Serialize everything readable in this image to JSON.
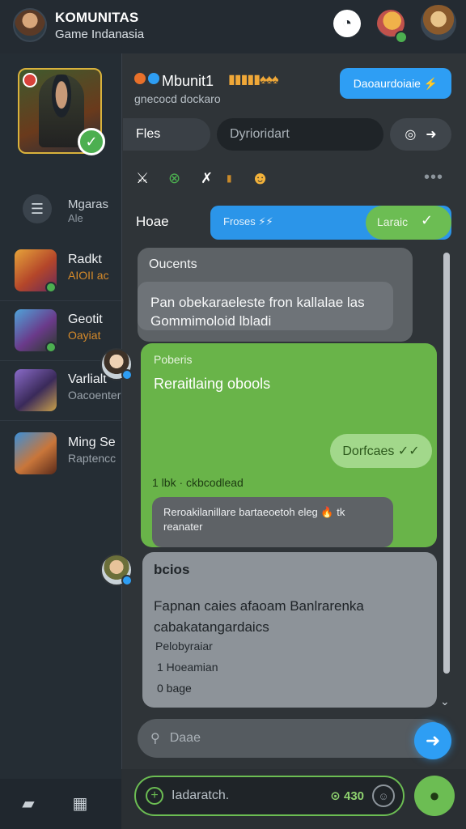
{
  "header": {
    "title": "KOMUNITAS",
    "subtitle": "Game Indanasia"
  },
  "sidebar": {
    "menu": {
      "title": "Mgaras",
      "sub": "Ale"
    },
    "games": [
      {
        "name": "Radkt",
        "sub": "AIOII ac",
        "sub_color": "#d58a2a"
      },
      {
        "name": "Geotit",
        "sub": "Oayiat",
        "sub_color": "#d58a2a"
      },
      {
        "name": "Varlialt",
        "sub": "Oacoenter",
        "sub_color": "#9aa3ab"
      },
      {
        "name": "Ming Se",
        "sub": "Raptencc",
        "sub_color": "#9aa3ab"
      }
    ]
  },
  "channel": {
    "title": "Mbunit1",
    "emoji": "▮▮▮▮▮♠♠♠",
    "subtitle": "gnecocd dockaro",
    "join_label": "Daoaurdoiaie ⚡"
  },
  "toolbar": {
    "files_label": "Fles",
    "search_placeholder": "Dyrioridart"
  },
  "progress": {
    "home_label": "Hoae",
    "label": "Froses ⚡⚡",
    "right_label": "Laraic",
    "value": 0.3
  },
  "messages": [
    {
      "title": "Oucents",
      "text": "Pan obekaraeleste fron kallalae las Gommimoloid lbladi"
    },
    {
      "author": "Poberis",
      "text": "Reraitlaing obools",
      "reply_label": "Dorfcaes ✓✓",
      "meta": "1 lbk · ckbcodlead",
      "quote": "Reroakilanillare bartaeoetoh eleg 🔥 tk reanater"
    },
    {
      "title": "bcios",
      "text": "Fapnan caies afaoam Banlrarenka cabakatangardaics",
      "line2": "Pelobyraiar",
      "line3": "1 Hoeamian",
      "line4": "0 bage"
    }
  ],
  "composer": {
    "placeholder": "Daae"
  },
  "bottom_input": {
    "placeholder": "Iadaratch.",
    "count": "⊙ 430"
  },
  "colors": {
    "accent_blue": "#2e9ef4",
    "accent_green": "#6cbd53",
    "background": "#1f262d"
  },
  "icons": {
    "clock": "clock-icon",
    "send": "send-arrow-icon",
    "mic": "mic-icon"
  }
}
